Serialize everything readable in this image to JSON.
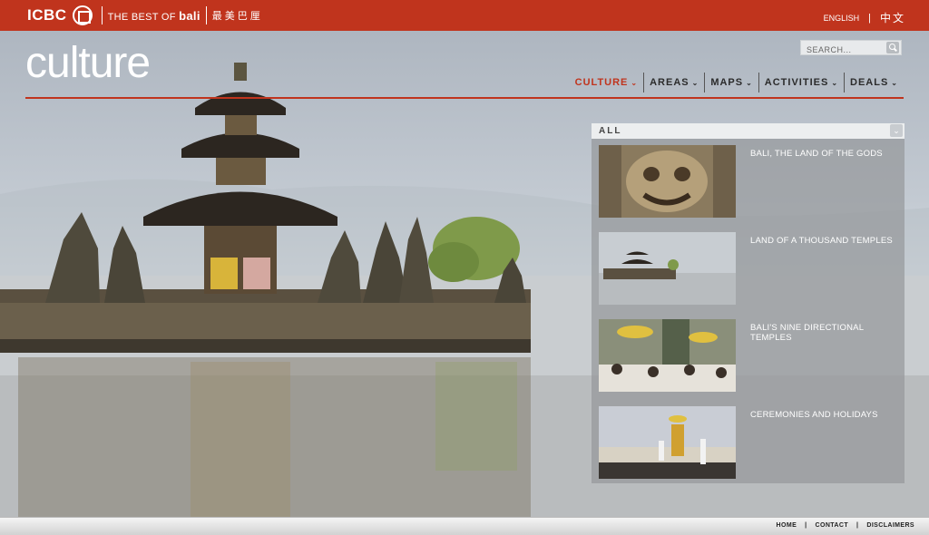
{
  "brand": {
    "logo_text": "ICBC",
    "tagline_prefix": "THE BEST OF",
    "tagline_bold": "bali",
    "chinese_name": "最美巴厘"
  },
  "language": {
    "english": "ENGLISH",
    "divider": "|",
    "chinese": "中文"
  },
  "page": {
    "title": "culture"
  },
  "search": {
    "placeholder": "SEARCH..."
  },
  "nav": [
    {
      "label": "CULTURE",
      "active": true
    },
    {
      "label": "AREAS"
    },
    {
      "label": "MAPS"
    },
    {
      "label": "ACTIVITIES"
    },
    {
      "label": "DEALS"
    }
  ],
  "filter": {
    "selected": "ALL"
  },
  "articles": [
    {
      "title": "BALI, THE LAND OF THE GODS",
      "thumb": "carved-barong-mask"
    },
    {
      "title": "LAND OF A THOUSAND TEMPLES",
      "thumb": "lake-temple"
    },
    {
      "title": "BALI'S NINE DIRECTIONAL TEMPLES",
      "thumb": "temple-procession-umbrellas"
    },
    {
      "title": "CEREMONIES AND HOLIDAYS",
      "thumb": "beach-ceremony"
    }
  ],
  "footer": {
    "links": [
      "HOME",
      "CONTACT",
      "DISCLAIMERS"
    ],
    "separator": "|"
  },
  "colors": {
    "brand_red": "#c0341d",
    "panel_gray": "#96989b"
  }
}
